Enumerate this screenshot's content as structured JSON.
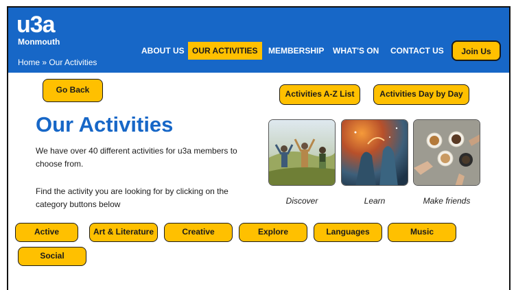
{
  "site": {
    "logo_main": "u3a",
    "logo_sub": "Monmouth"
  },
  "breadcrumb": "Home » Our Activities",
  "nav": {
    "items": [
      "ABOUT US",
      "OUR ACTIVITIES",
      "MEMBERSHIP",
      "WHAT'S ON",
      "CONTACT US"
    ],
    "active": "OUR ACTIVITIES",
    "join_label": "Join Us"
  },
  "actions": {
    "go_back": "Go Back",
    "az_list": "Activities A-Z List",
    "day_by_day": "Activities Day by Day"
  },
  "main": {
    "title": "Our Activities",
    "intro": "We have over 40 different activities for u3a members to choose from.",
    "instruction": "Find the activity you are looking for by clicking  on the category buttons below"
  },
  "photos": [
    {
      "caption": "Discover"
    },
    {
      "caption": "Learn"
    },
    {
      "caption": "Make friends"
    }
  ],
  "categories": [
    "Active",
    "Art & Literature",
    "Creative",
    "Explore",
    "Languages",
    "Music",
    "Social"
  ],
  "colors": {
    "brand_blue": "#1767c7",
    "accent_yellow": "#ffc000",
    "white": "#ffffff"
  }
}
